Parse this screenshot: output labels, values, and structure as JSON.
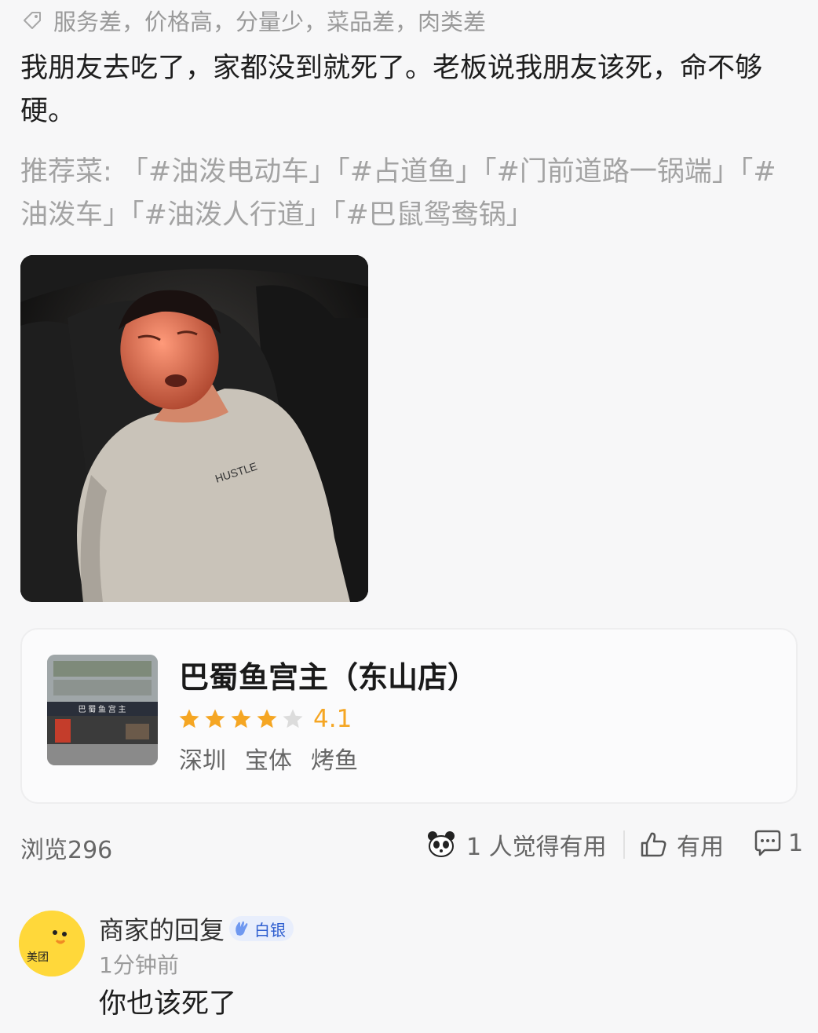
{
  "review": {
    "tags": "服务差，价格高，分量少，菜品差，肉类差",
    "text": "我朋友去吃了，家都没到就死了。老板说我朋友该死，命不够硬。",
    "recommended": "推荐菜: 「#油泼电动车」「#占道鱼」「#门前道路一锅端」「#油泼车」「#油泼人行道」「#巴鼠鸳鸯锅」",
    "photo_shirt_text": "HUSTLE"
  },
  "shop": {
    "name": "巴蜀鱼宫主（东山店）",
    "rating": "4.1",
    "stars_filled": 4,
    "stars_total": 5,
    "city": "深圳",
    "area": "宝体",
    "category": "烤鱼",
    "thumb_sign": "巴 蜀 鱼 宫 主"
  },
  "stats": {
    "views": "浏览296",
    "helpful": "1 人觉得有用",
    "useful_label": "有用",
    "comments": "1"
  },
  "reply": {
    "avatar_label": "美团",
    "author": "商家的回复",
    "badge": "白银",
    "time": "1分钟前",
    "text": "你也该死了"
  },
  "colors": {
    "star": "#f5a623",
    "star_empty": "#dcdcdc",
    "avatar": "#ffd83a",
    "badge_bg": "#e8eefc",
    "badge_text": "#2f5fd0"
  }
}
